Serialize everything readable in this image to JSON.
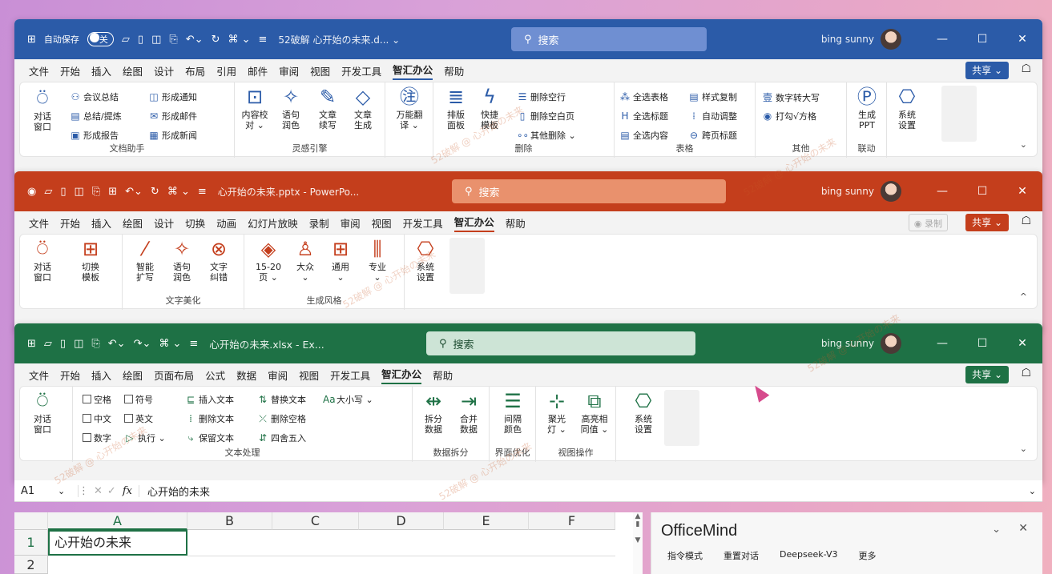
{
  "colors": {
    "word": "#2b5ba8",
    "ppt": "#c43e1c",
    "excel": "#1e7145",
    "word_search": "#6f8fd2",
    "ppt_search": "#e9916d",
    "excel_search": "#cde4d6"
  },
  "word": {
    "qa": {
      "autosave": "自动保存",
      "toggle": "关",
      "title": "52破解 心开始の未来.d...  ⌄",
      "search": "搜索",
      "user": "bing sunny"
    },
    "menu": [
      "文件",
      "开始",
      "插入",
      "绘图",
      "设计",
      "布局",
      "引用",
      "邮件",
      "审阅",
      "视图",
      "开发工具",
      "智汇办公",
      "帮助"
    ],
    "active": "智汇办公",
    "share": "共享 ⌄",
    "groups": {
      "g1": {
        "label": "文档助手",
        "b1": "对话\n窗口",
        "s": [
          "会议总结",
          "形成通知",
          "总结/提炼",
          "形成邮件",
          "形成报告",
          "形成新闻"
        ]
      },
      "g2": {
        "label": "灵感引擎",
        "b": [
          "内容校\n对 ⌄",
          "语句\n润色",
          "文章\n续写",
          "文章\n生成"
        ]
      },
      "g3": {
        "b": [
          "万能翻\n译 ⌄"
        ]
      },
      "g4": {
        "label": "删除",
        "b": [
          "排版\n面板",
          "快捷\n模板"
        ],
        "s": [
          "删除空行",
          "删除空白页",
          "其他删除 ⌄"
        ]
      },
      "g5": {
        "label": "表格",
        "s": [
          "全选表格",
          "样式复制",
          "全选标题",
          "自动调整",
          "全选内容",
          "跨页标题"
        ]
      },
      "g6": {
        "label": "其他",
        "s": [
          "数字转大写",
          "打勾√方格"
        ]
      },
      "g7": {
        "label": "联动",
        "b": [
          "生成\nPPT"
        ]
      },
      "g8": {
        "b": [
          "系统\n设置"
        ]
      }
    }
  },
  "ppt": {
    "qa": {
      "title": "心开始の未来.pptx  -  PowerPo...",
      "search": "搜索",
      "user": "bing sunny"
    },
    "menu": [
      "文件",
      "开始",
      "插入",
      "绘图",
      "设计",
      "切换",
      "动画",
      "幻灯片放映",
      "录制",
      "审阅",
      "视图",
      "开发工具",
      "智汇办公",
      "帮助"
    ],
    "active": "智汇办公",
    "share": "共享 ⌄",
    "record": "◉ 录制",
    "groups": {
      "g1": {
        "b": [
          "对话\n窗口",
          "切换\n模板"
        ]
      },
      "g2": {
        "label": "文字美化",
        "b": [
          "智能\n扩写",
          "语句\n润色",
          "文字\n纠错"
        ]
      },
      "g3": {
        "label": "生成风格",
        "b": [
          "15-20\n页 ⌄",
          "大众\n⌄",
          "通用\n⌄",
          "专业\n⌄"
        ]
      },
      "g4": {
        "b": [
          "系统\n设置"
        ]
      }
    }
  },
  "excel": {
    "qa": {
      "title": "心开始の未来.xlsx  -  Ex...",
      "search": "搜索",
      "user": "bing sunny"
    },
    "menu": [
      "文件",
      "开始",
      "插入",
      "绘图",
      "页面布局",
      "公式",
      "数据",
      "审阅",
      "视图",
      "开发工具",
      "智汇办公",
      "帮助"
    ],
    "active": "智汇办公",
    "share": "共享 ⌄",
    "groups": {
      "g1": {
        "b": [
          "对话\n窗口"
        ]
      },
      "g2": {
        "label": "文本处理",
        "c": [
          "空格",
          "符号",
          "中文",
          "英文",
          "数字"
        ],
        "exec": "执行 ⌄",
        "s": [
          "插入文本",
          "替换文本",
          "大小写 ⌄",
          "删除文本",
          "删除空格",
          "保留文本",
          "四舍五入"
        ]
      },
      "g3": {
        "label": "数据拆分",
        "b": [
          "拆分\n数据",
          "合并\n数据"
        ]
      },
      "g4": {
        "label": "界面优化",
        "b": [
          "间隔\n颜色"
        ]
      },
      "g5": {
        "label": "视图操作",
        "b": [
          "聚光\n灯 ⌄",
          "高亮相\n同值 ⌄"
        ]
      },
      "g6": {
        "b": [
          "系统\n设置"
        ]
      }
    },
    "formula": {
      "cell": "A1",
      "fx": "fx",
      "value": "心开始的未来"
    },
    "cols": [
      "A",
      "B",
      "C",
      "D",
      "E",
      "F"
    ],
    "rows": [
      "1",
      "2"
    ],
    "a1": "心开始の未来"
  },
  "panel": {
    "title": "OfficeMind",
    "tabs": [
      "指令模式",
      "重置对话",
      "Deepseek-V3",
      "更多"
    ]
  },
  "watermark": "52破解 @ 心开始の未来"
}
